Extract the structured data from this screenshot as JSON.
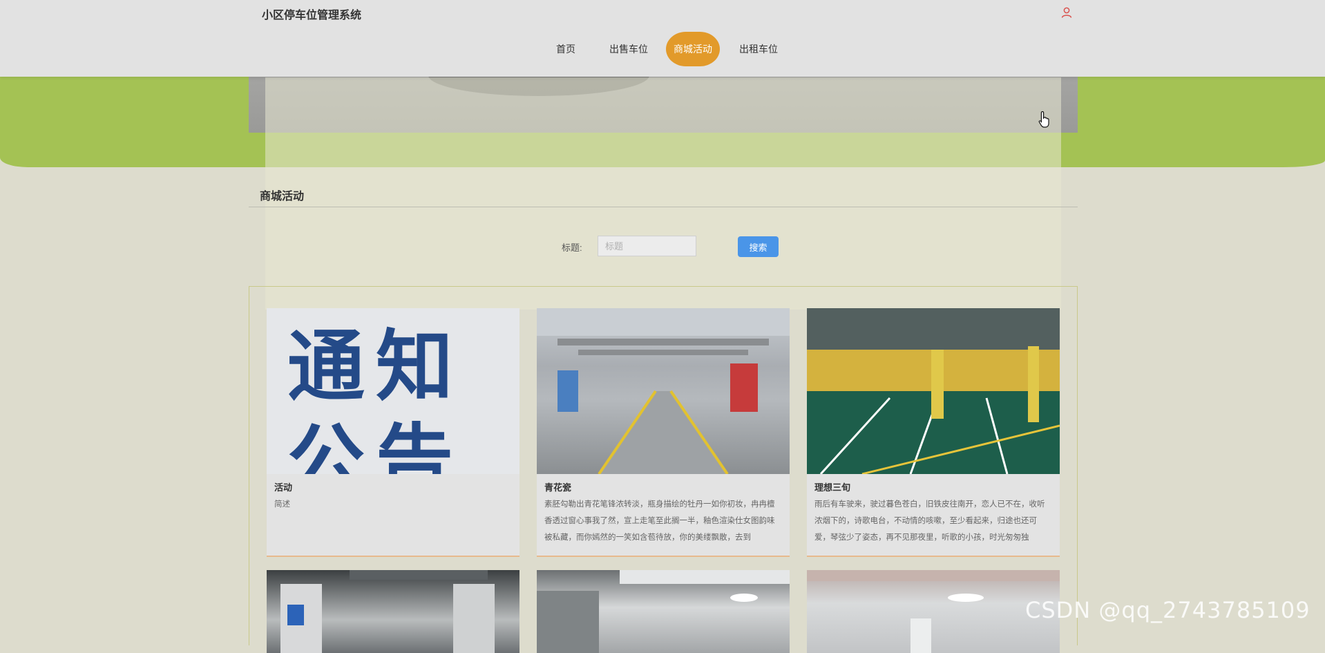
{
  "header": {
    "site_title": "小区停车位管理系统",
    "nav": [
      {
        "label": "首页"
      },
      {
        "label": "出售车位"
      },
      {
        "label": "商城活动",
        "active": true
      },
      {
        "label": "出租车位"
      }
    ]
  },
  "section": {
    "title": "商城活动"
  },
  "search": {
    "label": "标题:",
    "placeholder": "标题",
    "value": "",
    "button_label": "搜索"
  },
  "cards": [
    {
      "title": "活动",
      "description": "简述",
      "image": "notice-poster",
      "image_text": [
        "通知",
        "公告"
      ]
    },
    {
      "title": "青花瓷",
      "description": "素胚勾勒出青花笔锋浓转淡，瓶身描绘的牡丹一如你初妆，冉冉檀香透过窗心事我了然，宣上走笔至此搁一半，釉色渲染仕女图韵味被私藏，而你嫣然的一笑如含苞待放，你的美缕飘散，去到",
      "image": "parking-garage-gray"
    },
    {
      "title": "理想三旬",
      "description": "雨后有车驶来，驶过暮色苍白，旧铁皮往南开，恋人已不在，收听浓烟下的，诗歌电台，不动情的咳嗽，至少看起来，归途也还可爱，琴弦少了姿态，再不见那夜里，听歌的小孩，时光匆匆独",
      "image": "parking-garage-green"
    }
  ],
  "more_cards": [
    {
      "image": "parking-garage-pillar"
    },
    {
      "image": "parking-garage-shutter"
    },
    {
      "image": "parking-garage-lights"
    }
  ],
  "icons": {
    "user": "user-icon",
    "cursor": "hand-cursor-icon"
  },
  "colors": {
    "accent": "#e29a2a",
    "primary_button": "#4a95e8",
    "band": "#a4c254"
  },
  "watermark": "CSDN @qq_2743785109"
}
